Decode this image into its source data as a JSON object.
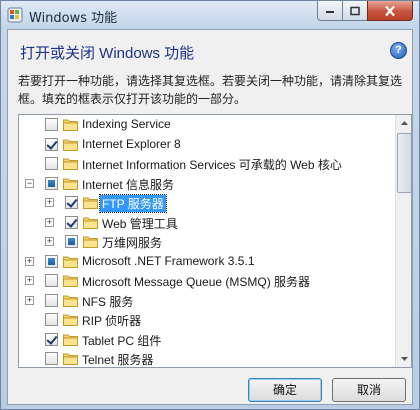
{
  "window": {
    "title": "Windows 功能"
  },
  "header": {
    "heading": "打开或关闭 Windows 功能",
    "description": "若要打开一种功能，请选择其复选框。若要关闭一种功能，请清除其复选框。填充的框表示仅打开该功能的一部分。"
  },
  "features": [
    {
      "label": "Indexing Service",
      "state": "unchecked",
      "level": 0,
      "expander": "none"
    },
    {
      "label": "Internet Explorer 8",
      "state": "checked",
      "level": 0,
      "expander": "none"
    },
    {
      "label": "Internet Information Services 可承载的 Web 核心",
      "state": "unchecked",
      "level": 0,
      "expander": "none"
    },
    {
      "label": "Internet 信息服务",
      "state": "partial",
      "level": 0,
      "expander": "minus"
    },
    {
      "label": "FTP 服务器",
      "state": "checked",
      "level": 1,
      "expander": "plus",
      "selected": true
    },
    {
      "label": "Web 管理工具",
      "state": "checked",
      "level": 1,
      "expander": "plus"
    },
    {
      "label": "万维网服务",
      "state": "partial",
      "level": 1,
      "expander": "plus"
    },
    {
      "label": "Microsoft .NET Framework 3.5.1",
      "state": "partial",
      "level": 0,
      "expander": "plus"
    },
    {
      "label": "Microsoft Message Queue (MSMQ) 服务器",
      "state": "unchecked",
      "level": 0,
      "expander": "plus"
    },
    {
      "label": "NFS 服务",
      "state": "unchecked",
      "level": 0,
      "expander": "plus"
    },
    {
      "label": "RIP 侦听器",
      "state": "unchecked",
      "level": 0,
      "expander": "none"
    },
    {
      "label": "Tablet PC 组件",
      "state": "checked",
      "level": 0,
      "expander": "none"
    },
    {
      "label": "Telnet 服务器",
      "state": "unchecked",
      "level": 0,
      "expander": "none"
    }
  ],
  "buttons": {
    "ok": "确定",
    "cancel": "取消"
  }
}
